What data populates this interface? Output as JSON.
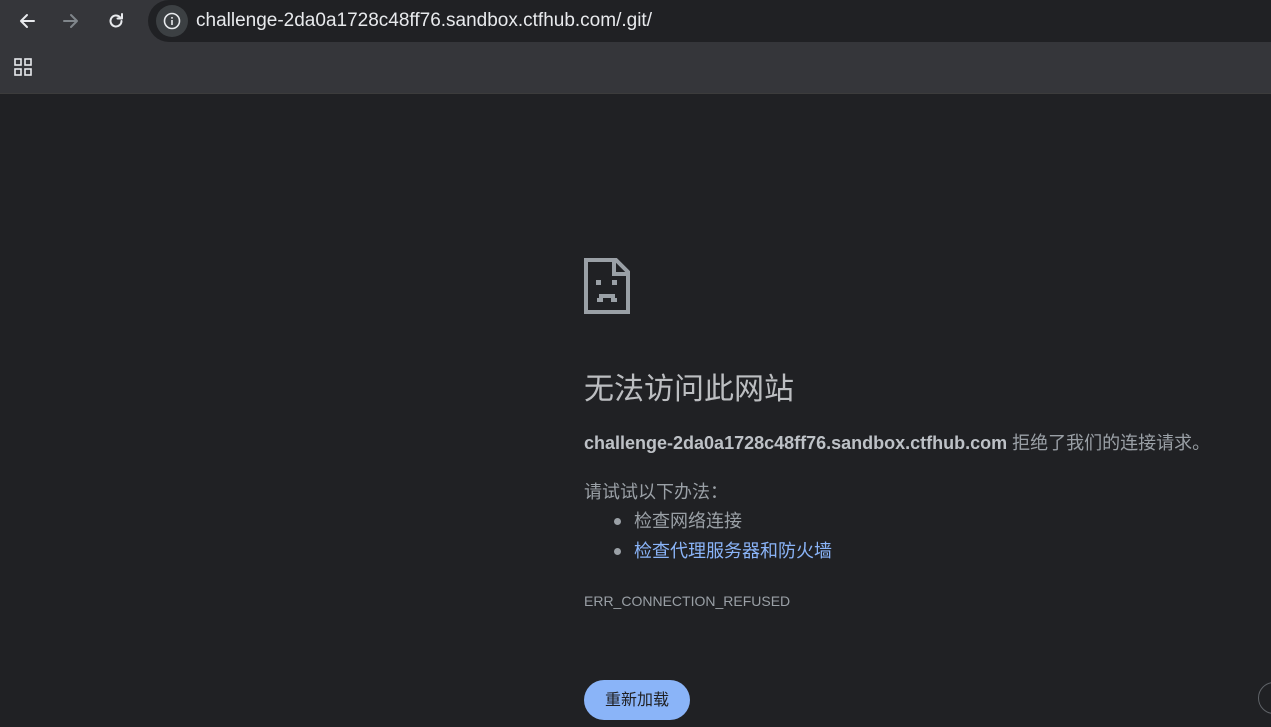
{
  "browser": {
    "url": "challenge-2da0a1728c48ff76.sandbox.ctfhub.com/.git/",
    "back_icon": "arrow-left-icon",
    "forward_icon": "arrow-right-icon",
    "reload_icon": "reload-icon",
    "site_info_icon": "info-icon",
    "apps_icon": "apps-grid-icon"
  },
  "error": {
    "icon": "sad-document-icon",
    "title": "无法访问此网站",
    "host": "challenge-2da0a1728c48ff76.sandbox.ctfhub.com",
    "summary_suffix": " 拒绝了我们的连接请求。",
    "suggest_title": "请试试以下办法：",
    "suggestions": [
      {
        "label": "检查网络连接",
        "link": false
      },
      {
        "label": "检查代理服务器和防火墙",
        "link": true
      }
    ],
    "code": "ERR_CONNECTION_REFUSED",
    "reload_label": "重新加载"
  },
  "colors": {
    "page_bg": "#202124",
    "toolbar_bg": "#35363a",
    "link": "#8ab4f8",
    "button_bg": "#8ab4f8"
  }
}
